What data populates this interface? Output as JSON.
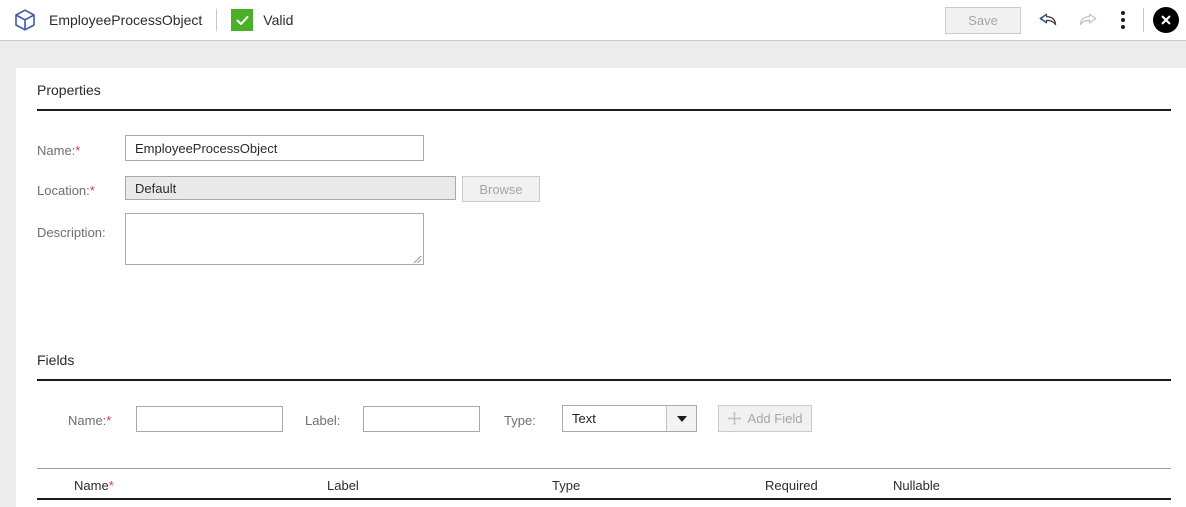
{
  "header": {
    "object_icon": "cube-icon",
    "object_title": "EmployeeProcessObject",
    "status_icon": "check-icon",
    "status_label": "Valid",
    "save_label": "Save",
    "undo_icon": "undo-arrow-icon",
    "redo_icon": "redo-arrow-icon",
    "more_icon": "kebab-menu-icon",
    "close_icon": "close-circle-icon",
    "status_color": "#4caf28"
  },
  "properties": {
    "section_label": "Properties",
    "name_label": "Name:",
    "name_required": "*",
    "name_value": "EmployeeProcessObject",
    "location_label": "Location:",
    "location_required": "*",
    "location_value": "Default",
    "browse_label": "Browse",
    "description_label": "Description:",
    "description_value": "",
    "description_placeholder": ""
  },
  "fields": {
    "section_label": "Fields",
    "name_label": "Name:",
    "name_required": "*",
    "name_value": "",
    "label_label": "Label:",
    "label_value": "",
    "type_label": "Type:",
    "type_value": "Text",
    "type_options": [
      "Text"
    ],
    "add_field_label": "Add Field",
    "add_field_icon": "plus-icon",
    "table": {
      "columns": [
        {
          "label": "Name",
          "required": "*"
        },
        {
          "label": "Label",
          "required": ""
        },
        {
          "label": "Type",
          "required": ""
        },
        {
          "label": "Required",
          "required": ""
        },
        {
          "label": "Nullable",
          "required": ""
        }
      ],
      "rows": []
    }
  },
  "colors": {
    "required_asterisk": "#e23b3b",
    "valid_green": "#4caf28",
    "panel_bg": "#ffffff",
    "chrome_bg": "#ececec"
  }
}
